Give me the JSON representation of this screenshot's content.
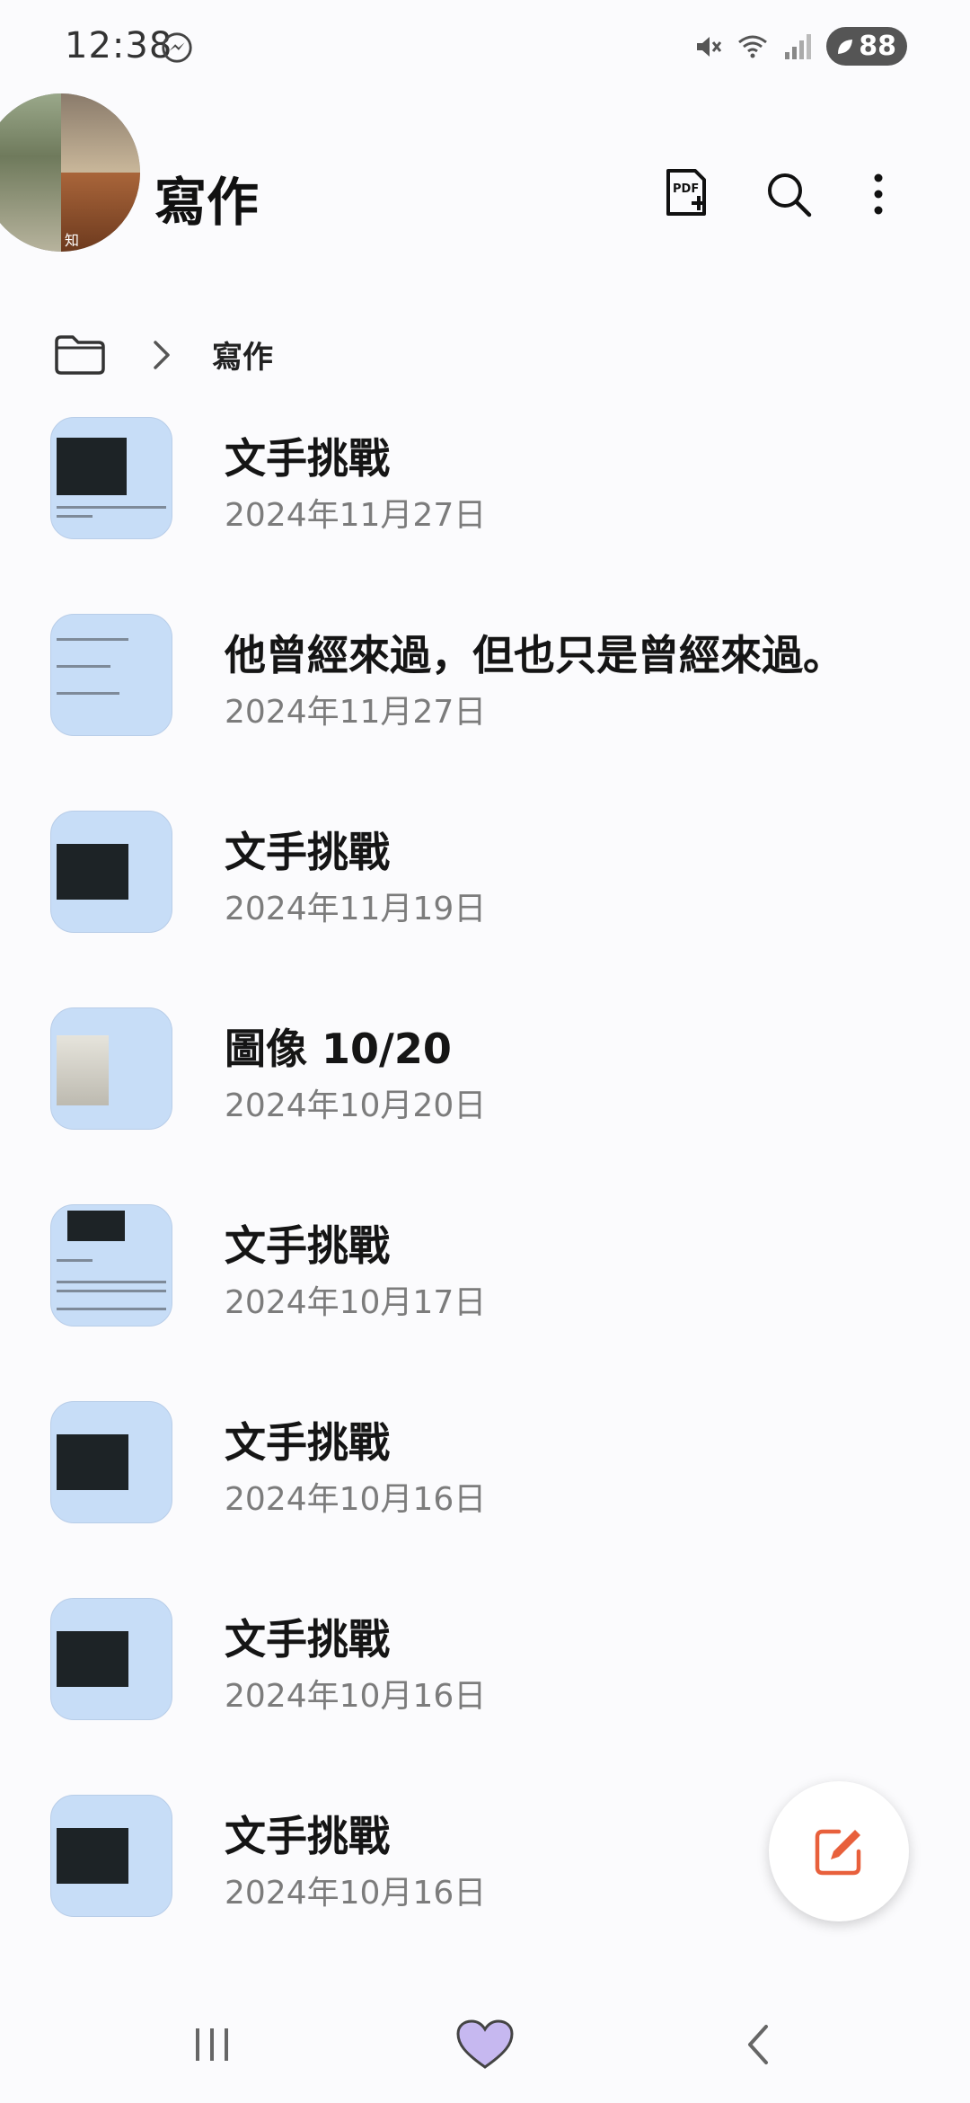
{
  "status_bar": {
    "time": "12:38",
    "battery": "88",
    "icons": [
      "messenger-icon",
      "mute-icon",
      "wifi-icon",
      "signal-icon",
      "battery-icon"
    ]
  },
  "header": {
    "title": "寫作",
    "actions": [
      "pdf-add-icon",
      "search-icon",
      "more-vert-icon"
    ],
    "avatar_text": "知"
  },
  "breadcrumb": {
    "label": "寫作"
  },
  "notes": [
    {
      "title": "文手挑戰",
      "date": "2024年11月27日",
      "thumb": "dark-top"
    },
    {
      "title": "他曾經來過，但也只是曾經來過。",
      "date": "2024年11月27日",
      "thumb": "text"
    },
    {
      "title": "文手挑戰",
      "date": "2024年11月19日",
      "thumb": "dark-center"
    },
    {
      "title": "圖像 10/20",
      "date": "2024年10月20日",
      "thumb": "photo"
    },
    {
      "title": "文手挑戰",
      "date": "2024年10月17日",
      "thumb": "dark-top-text"
    },
    {
      "title": "文手挑戰",
      "date": "2024年10月16日",
      "thumb": "dark-center"
    },
    {
      "title": "文手挑戰",
      "date": "2024年10月16日",
      "thumb": "dark-center"
    },
    {
      "title": "文手挑戰",
      "date": "2024年10月16日",
      "thumb": "dark-center"
    }
  ],
  "colors": {
    "thumb_bg": "#c7ddf7",
    "fab_icon": "#e8603c",
    "home_heart": "#c6b8f0"
  }
}
